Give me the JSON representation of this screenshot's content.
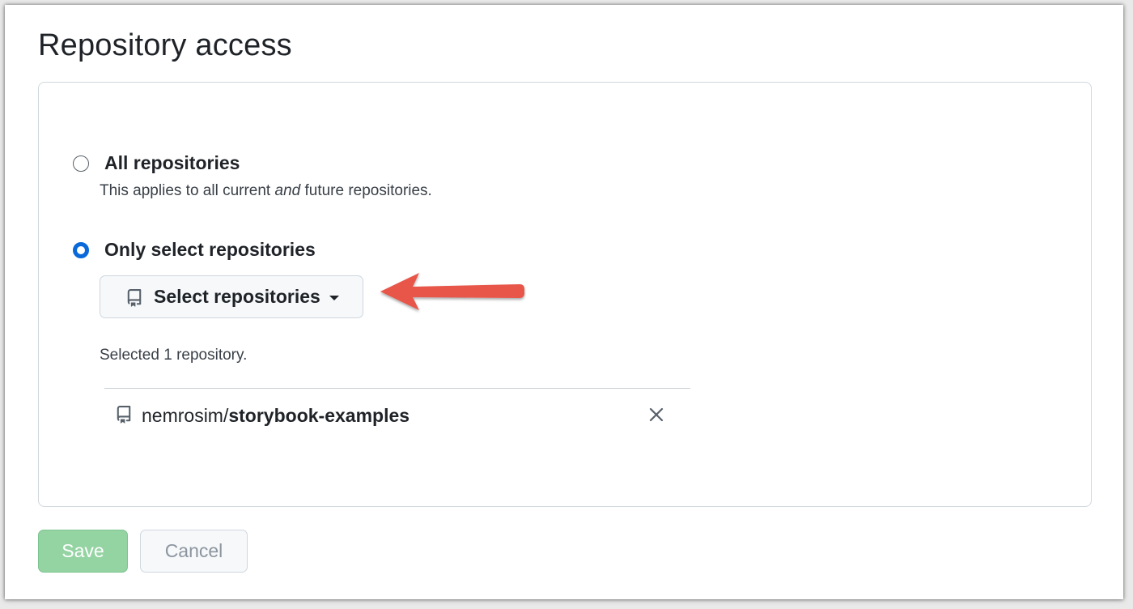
{
  "page": {
    "title": "Repository access"
  },
  "options": {
    "all": {
      "label": "All repositories",
      "desc_before": "This applies to all current ",
      "desc_emphasis": "and",
      "desc_after": " future repositories.",
      "checked": false
    },
    "select": {
      "label": "Only select repositories",
      "checked": true
    }
  },
  "select_button": {
    "label": "Select repositories",
    "icon": "repo-icon"
  },
  "selection": {
    "count_text": "Selected 1 repository.",
    "repos": [
      {
        "owner": "nemrosim/",
        "name": "storybook-examples"
      }
    ]
  },
  "actions": {
    "save_label": "Save",
    "cancel_label": "Cancel"
  },
  "colors": {
    "accent": "#0969da",
    "save_disabled": "#94d3a2",
    "annotation_arrow": "#e8544a"
  }
}
